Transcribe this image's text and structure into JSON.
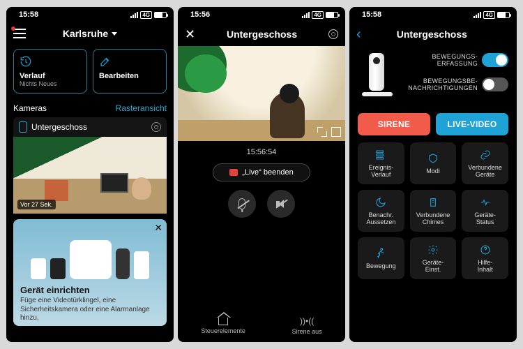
{
  "status": {
    "time_a": "15:58",
    "time_b": "15:56",
    "time_c": "15:58",
    "net": "4G"
  },
  "s1": {
    "location": "Karlsruhe",
    "tile_history_label": "Verlauf",
    "tile_history_sub": "Nichts Neues",
    "tile_edit_label": "Bearbeiten",
    "section_cameras": "Kameras",
    "grid_link": "Rasteransicht",
    "camera_name": "Untergeschoss",
    "preview_time": "Vor 27 Sek.",
    "promo_title": "Gerät einrichten",
    "promo_text": "Füge eine Videotürklingel, eine Sicherheitskamera oder eine Alarmanlage hinzu,"
  },
  "s2": {
    "title": "Untergeschoss",
    "timestamp": "15:56:54",
    "end_live": "„Live“ beenden",
    "nav_controls": "Steuerelemente",
    "nav_siren": "Sirene aus"
  },
  "s3": {
    "title": "Untergeschoss",
    "toggle_motion_detect": "BEWEGUNGS-\nERFASSUNG",
    "toggle_motion_notif": "BEWEGUNGSBE-\nNACHRICHTIGUNGEN",
    "toggle_motion_detect_on": true,
    "toggle_motion_notif_on": false,
    "pill_siren": "SIRENE",
    "pill_live": "LIVE-VIDEO",
    "tiles": [
      "Ereignis-\nVerlauf",
      "Modi",
      "Verbundene\nGeräte",
      "Benachr.\nAussetzen",
      "Verbundene\nChimes",
      "Geräte-\nStatus",
      "Bewegung",
      "Geräte-\nEinst.",
      "Hilfe-\nInhalt"
    ],
    "tile_names": [
      "tile-event-history",
      "tile-modes",
      "tile-linked-devices",
      "tile-snooze-notif",
      "tile-linked-chimes",
      "tile-device-status",
      "tile-motion",
      "tile-device-settings",
      "tile-help"
    ],
    "tile_icons": [
      "history-icon",
      "shield-icon",
      "link-icon",
      "moon-icon",
      "chime-icon",
      "heartbeat-icon",
      "running-icon",
      "gear-icon",
      "question-icon"
    ]
  }
}
